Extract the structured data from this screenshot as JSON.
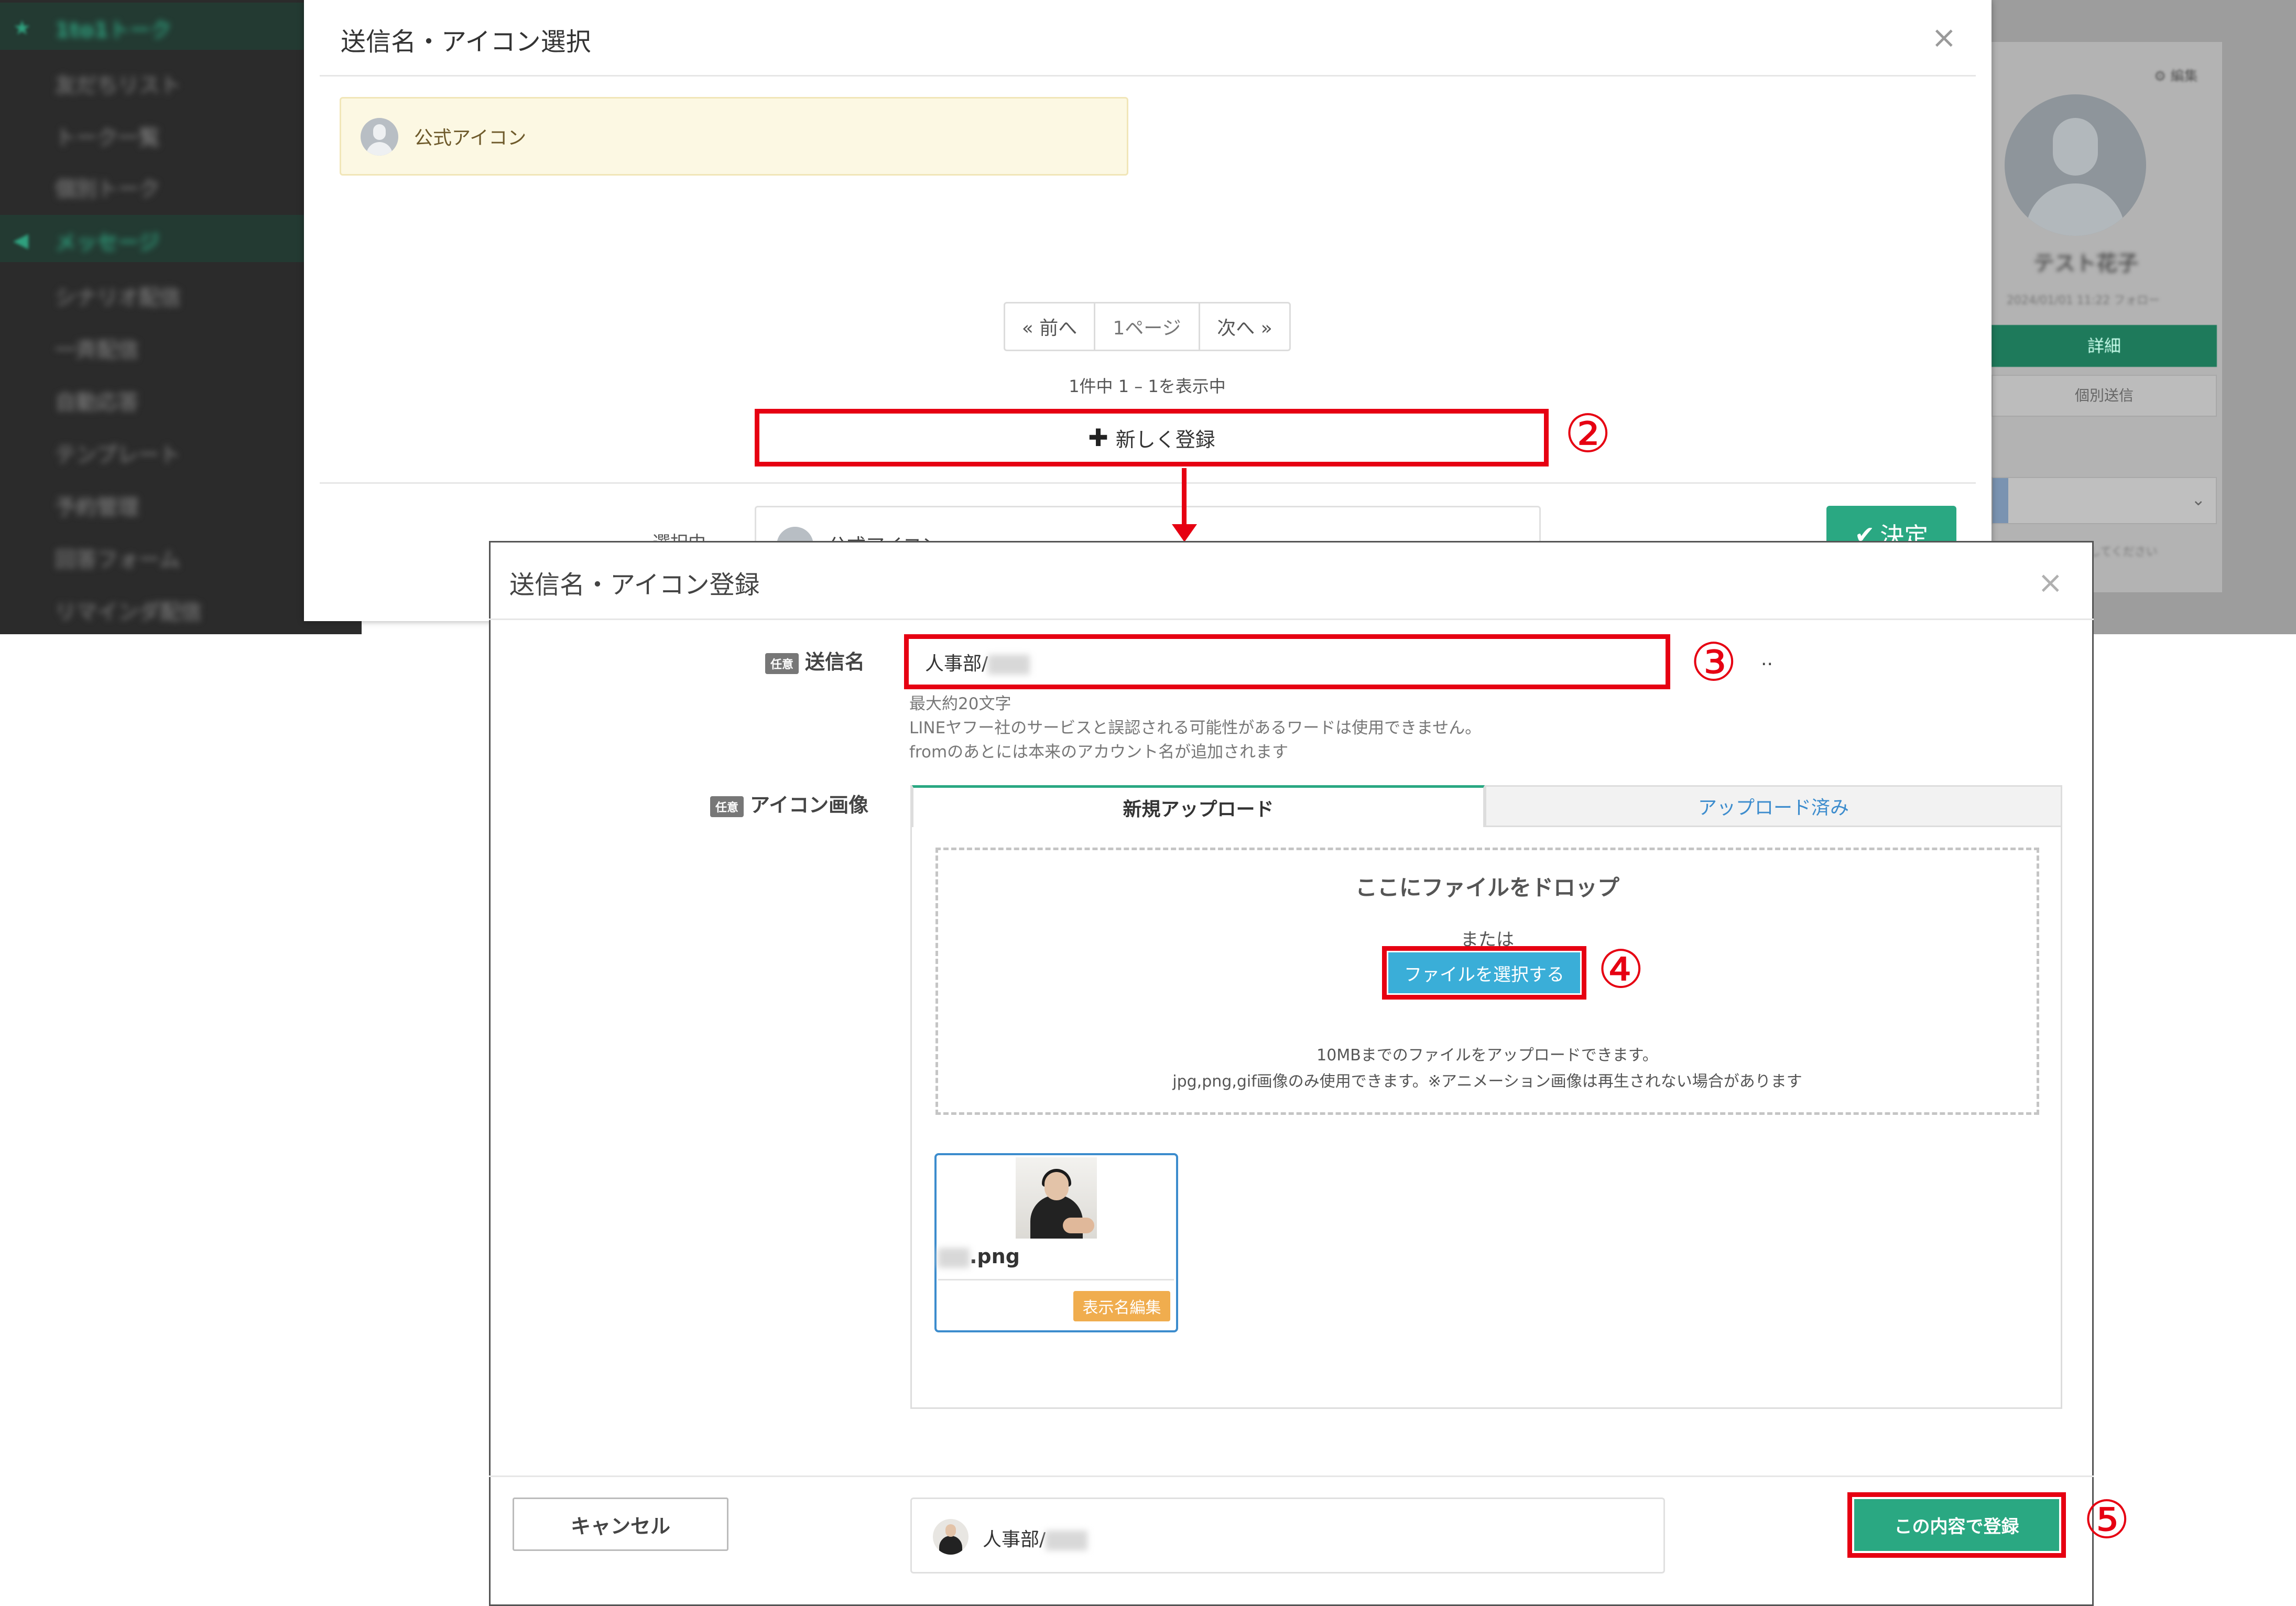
{
  "sidebar": {
    "items": [
      {
        "label": "1to1トーク",
        "section": true,
        "icon": "star-icon"
      },
      {
        "label": "友だちリスト",
        "section": false
      },
      {
        "label": "トーク一覧",
        "section": false
      },
      {
        "label": "個別トーク",
        "section": false
      },
      {
        "label": "メッセージ",
        "section": true,
        "icon": "megaphone-icon"
      },
      {
        "label": "シナリオ配信",
        "section": false
      },
      {
        "label": "一斉配信",
        "section": false
      },
      {
        "label": "自動応答",
        "section": false
      },
      {
        "label": "テンプレート",
        "section": false
      },
      {
        "label": "予約管理",
        "section": false
      },
      {
        "label": "回答フォーム",
        "section": false
      },
      {
        "label": "リマインダ配信",
        "section": false
      }
    ]
  },
  "profile": {
    "top_link": "⚙ 編集",
    "name": "テスト花子",
    "sub": "2024/01/01 11:22 フォロー",
    "button1": "詳細",
    "button2": "個別送信",
    "note": "対応マークを選択してください"
  },
  "select_modal": {
    "title": "送信名・アイコン選択",
    "close": "×",
    "official_icon_label": "公式アイコン",
    "pager": {
      "prev": "« 前へ",
      "current": "1ページ",
      "next": "次へ »"
    },
    "page_info": "1件中 1 – 1を表示中",
    "new_button": "新しく登録",
    "footer_label": "選択中",
    "footer_value": "公式アイコン",
    "decide_button": "決定"
  },
  "register_modal": {
    "title": "送信名・アイコン登録",
    "close": "×",
    "optional_tag": "任意",
    "sender_label": "送信名",
    "sender_value": "人事部/",
    "sender_ellipsis": "..",
    "sender_help": [
      "最大約20文字",
      "LINEヤフー社のサービスと誤認される可能性があるワードは使用できません。",
      "fromのあとには本来のアカウント名が追加されます"
    ],
    "icon_label": "アイコン画像",
    "tabs": [
      {
        "label": "新規アップロード",
        "active": true
      },
      {
        "label": "アップロード済み",
        "active": false
      }
    ],
    "dropzone": {
      "title": "ここにファイルをドロップ",
      "or": "または",
      "select_button": "ファイルを選択する",
      "note1": "10MBまでのファイルをアップロードできます。",
      "note2": "jpg,png,gif画像のみ使用できます。※アニメーション画像は再生されない場合があります"
    },
    "uploaded_file": {
      "name": ".png",
      "edit_button": "表示名編集"
    },
    "cancel_button": "キャンセル",
    "preview_text": "人事部/",
    "register_button": "この内容で登録"
  },
  "callouts": {
    "step2": "②",
    "step3": "③",
    "step4": "④",
    "step5": "⑤"
  },
  "colors": {
    "accent_green": "#2aa882",
    "highlight_red": "#e60012",
    "link_blue": "#3c8ccd",
    "file_button_blue": "#3aaed8",
    "edit_orange": "#f0ad4e"
  }
}
